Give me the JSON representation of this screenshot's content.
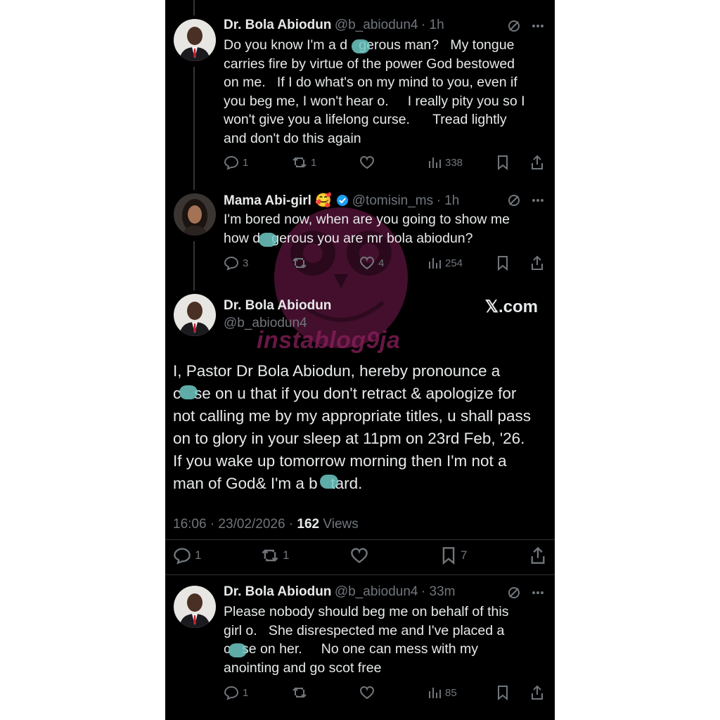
{
  "tweets": [
    {
      "name": "Dr. Bola Abiodun",
      "handle": "@b_abiodun4",
      "time": "· 1h",
      "text": "Do you know I'm a d   gerous man?   My tongue\ncarries fire by virtue of the power God bestowed\non me.   If I do what's on my mind to you, even if\nyou beg me, I won't hear o.     I really pity you so I\nwon't give you a lifelong curse.      Tread lightly\nand don't do this again",
      "replies": "1",
      "retweets": "1",
      "likes": "",
      "views": "338"
    },
    {
      "name": "Mama Abi-girl 🥰",
      "handle": "@tomisin_ms",
      "time": "· 1h",
      "text": "I'm bored now, when are you going to show me\nhow d   gerous you are mr bola abiodun?",
      "replies": "3",
      "retweets": "",
      "likes": "4",
      "views": "254"
    },
    {
      "name": "Dr. Bola Abiodun",
      "handle": "@b_abiodun4",
      "time": "· 33m",
      "text": "Please nobody should beg me on behalf of this\ngirl o.   She disrespected me and I've placed a\nc   se on her.     No one can mess with my\nanointing and go scot free",
      "replies": "1",
      "retweets": "",
      "likes": "",
      "views": "85"
    }
  ],
  "main_tweet": {
    "name": "Dr. Bola Abiodun",
    "handle": "@b_abiodun4",
    "brand": "𝕏.com",
    "text": "I, Pastor Dr Bola Abiodun, hereby pronounce a\nc   se on u that if you don't retract & apologize for\nnot calling me by my appropriate titles, u shall pass\non to glory in your sleep at 11pm on 23rd Feb, '26.\nIf you wake up tomorrow morning then I'm not a\nman of God& I'm a b   tard.",
    "timestamp": "16:06 · 23/02/2026 · ",
    "views_count": "162",
    "views_label": " Views",
    "replies": "1",
    "retweets": "1",
    "bookmarks": "7"
  },
  "watermark": "instablog9ja",
  "colors": {
    "background": "#000000",
    "text": "#e7e9ea",
    "muted": "#71767b",
    "verified": "#1d9bf0",
    "redaction": "#6fc9c4",
    "watermark": "#8a1f5c"
  }
}
